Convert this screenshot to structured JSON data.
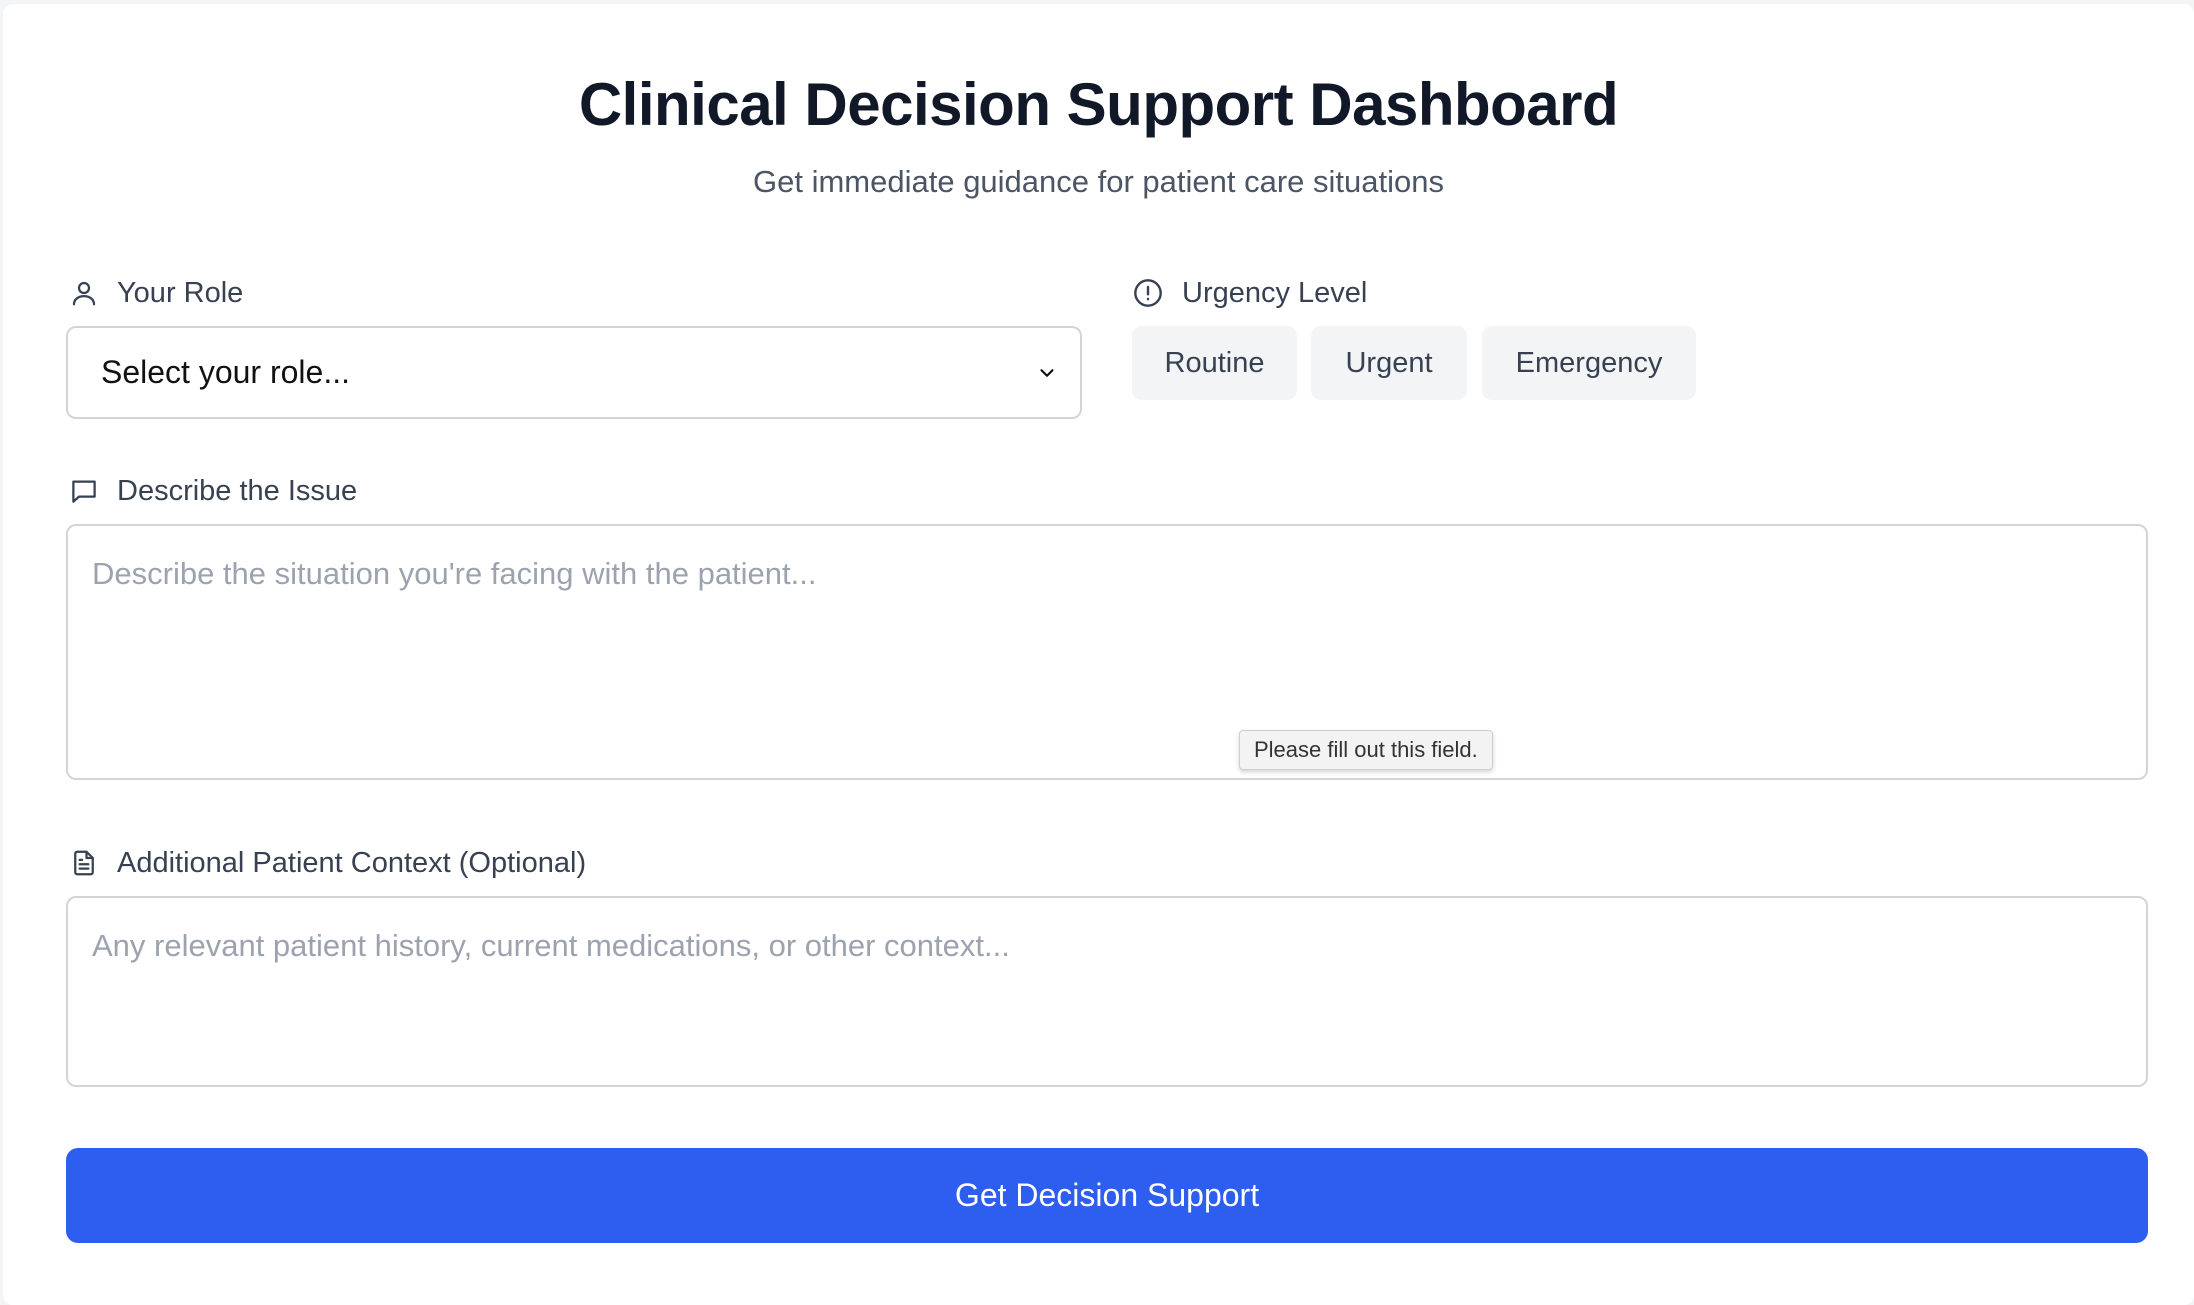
{
  "header": {
    "title": "Clinical Decision Support Dashboard",
    "subtitle": "Get immediate guidance for patient care situations"
  },
  "role": {
    "label": "Your Role",
    "icon": "user-icon",
    "selected_value": "Select your role..."
  },
  "urgency": {
    "label": "Urgency Level",
    "icon": "alert-circle-icon",
    "options": [
      "Routine",
      "Urgent",
      "Emergency"
    ]
  },
  "issue": {
    "label": "Describe the Issue",
    "icon": "message-square-icon",
    "placeholder": "Describe the situation you're facing with the patient...",
    "validation_message": "Please fill out this field."
  },
  "context": {
    "label": "Additional Patient Context (Optional)",
    "icon": "file-text-icon",
    "placeholder": "Any relevant patient history, current medications, or other context..."
  },
  "submit": {
    "label": "Get Decision Support"
  },
  "colors": {
    "primary": "#2d5ef0",
    "text_dark": "#111827",
    "text_muted": "#4b5563",
    "border": "#d1d5db",
    "chip_bg": "#f3f4f6"
  }
}
